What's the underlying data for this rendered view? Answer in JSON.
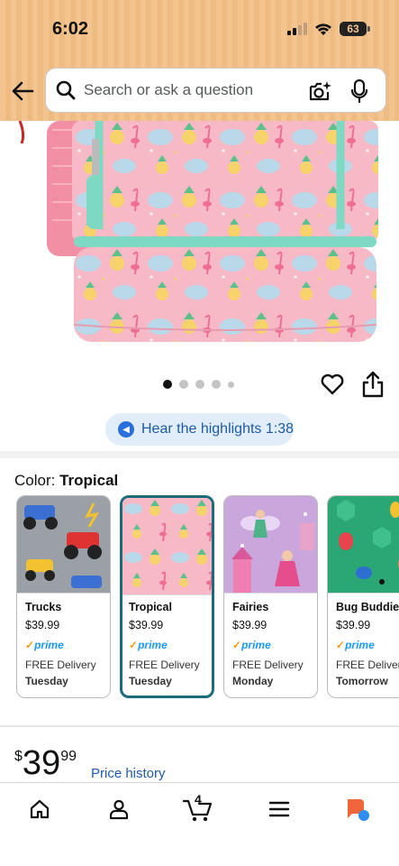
{
  "status_bar": {
    "time": "6:02",
    "battery": "63"
  },
  "search": {
    "placeholder": "Search or ask a question"
  },
  "carousel": {
    "count": 5,
    "active_index": 0
  },
  "hear_highlights": {
    "label": "Hear the highlights 1:38"
  },
  "color": {
    "prefix": "Color: ",
    "selected": "Tropical"
  },
  "swatches": [
    {
      "name": "Trucks",
      "price": "$39.99",
      "prime": "prime",
      "delivery": "FREE Delivery",
      "day": "Tuesday",
      "selected": false
    },
    {
      "name": "Tropical",
      "price": "$39.99",
      "prime": "prime",
      "delivery": "FREE Delivery",
      "day": "Tuesday",
      "selected": true
    },
    {
      "name": "Fairies",
      "price": "$39.99",
      "prime": "prime",
      "delivery": "FREE Delivery",
      "day": "Monday",
      "selected": false
    },
    {
      "name": "Bug Buddies",
      "price": "$39.99",
      "prime": "prime",
      "delivery": "FREE Delivery",
      "day": "Tomorrow",
      "selected": false
    }
  ],
  "price": {
    "currency": "$",
    "whole": "39",
    "fraction": "99",
    "history_label": "Price history"
  },
  "bottom_nav": {
    "cart_count": "4"
  },
  "colors": {
    "accent_blue": "#1f5aa6",
    "prime_blue": "#1a98ff",
    "selected_border": "#1b6b7c",
    "header": "#f3c48f",
    "tropical_pink": "#f6b6c4",
    "mint": "#7ed9c2"
  }
}
